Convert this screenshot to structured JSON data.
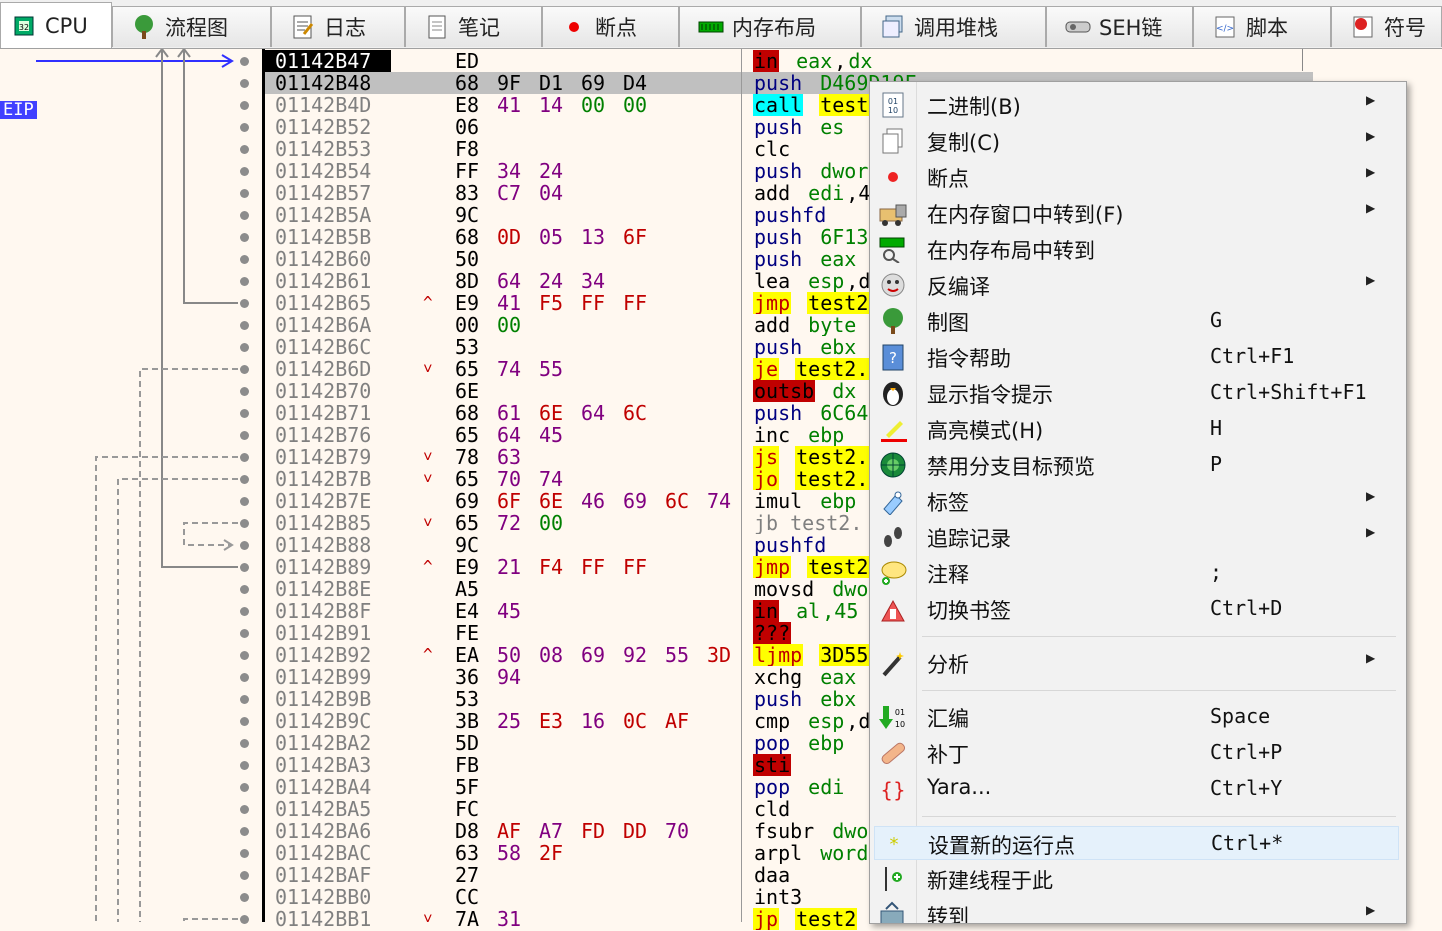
{
  "tabs": [
    {
      "label": "CPU",
      "icon": "cpu-icon",
      "active": true
    },
    {
      "label": "流程图",
      "icon": "tree-icon"
    },
    {
      "label": "日志",
      "icon": "log-icon"
    },
    {
      "label": "笔记",
      "icon": "notes-icon"
    },
    {
      "label": "断点",
      "icon": "breakpoint-icon"
    },
    {
      "label": "内存布局",
      "icon": "memory-map-icon"
    },
    {
      "label": "调用堆栈",
      "icon": "call-stack-icon"
    },
    {
      "label": "SEH链",
      "icon": "seh-chain-icon"
    },
    {
      "label": "脚本",
      "icon": "script-icon"
    },
    {
      "label": "符号",
      "icon": "symbols-icon"
    }
  ],
  "eip_label": "EIP",
  "rows": [
    {
      "addr": "01142B47",
      "bytes": [
        "ED"
      ],
      "ins": [
        [
          "in",
          "mnem-red"
        ],
        [
          " "
        ],
        [
          "eax",
          "op-g"
        ],
        [
          ","
        ],
        [
          "dx",
          "op-g"
        ]
      ],
      "cur": true
    },
    {
      "addr": "01142B48",
      "bytes": [
        "68",
        "9F",
        "D1",
        "69",
        "D4"
      ],
      "ins": [
        [
          "push",
          "mnem"
        ],
        [
          " "
        ],
        [
          "D469D19F",
          "op-g"
        ]
      ],
      "sel": true
    },
    {
      "addr": "01142B4D",
      "bytes": [
        "E8",
        "41",
        "14",
        "00",
        "00"
      ],
      "ins": [
        [
          "call",
          "mnem-cyan"
        ],
        [
          " "
        ],
        [
          "test",
          "op-y"
        ]
      ]
    },
    {
      "addr": "01142B52",
      "bytes": [
        "06"
      ],
      "ins": [
        [
          "push",
          "mnem"
        ],
        [
          " "
        ],
        [
          "es",
          "op-g"
        ]
      ]
    },
    {
      "addr": "01142B53",
      "bytes": [
        "F8"
      ],
      "ins": [
        [
          "clc",
          "plain"
        ]
      ]
    },
    {
      "addr": "01142B54",
      "bytes": [
        "FF",
        "34",
        "24"
      ],
      "ins": [
        [
          "push",
          "mnem"
        ],
        [
          " "
        ],
        [
          "dwor",
          "op-g"
        ]
      ]
    },
    {
      "addr": "01142B57",
      "bytes": [
        "83",
        "C7",
        "04"
      ],
      "ins": [
        [
          "add",
          "plain"
        ],
        [
          " "
        ],
        [
          "edi",
          "op-g"
        ],
        [
          ",4",
          "plain"
        ]
      ]
    },
    {
      "addr": "01142B5A",
      "bytes": [
        "9C"
      ],
      "ins": [
        [
          "pushfd",
          "mnem"
        ]
      ]
    },
    {
      "addr": "01142B5B",
      "bytes": [
        "68",
        "0D",
        "05",
        "13",
        "6F"
      ],
      "ins": [
        [
          "push",
          "mnem"
        ],
        [
          " "
        ],
        [
          "6F13",
          "op-g"
        ]
      ]
    },
    {
      "addr": "01142B60",
      "bytes": [
        "50"
      ],
      "ins": [
        [
          "push",
          "mnem"
        ],
        [
          " "
        ],
        [
          "eax",
          "op-g"
        ]
      ]
    },
    {
      "addr": "01142B61",
      "bytes": [
        "8D",
        "64",
        "24",
        "34"
      ],
      "ins": [
        [
          "lea",
          "plain"
        ],
        [
          " "
        ],
        [
          "esp",
          "op-g"
        ],
        [
          ",d",
          "plain"
        ]
      ]
    },
    {
      "addr": "01142B65",
      "mark": "^",
      "bytes": [
        "E9",
        "41",
        "F5",
        "FF",
        "FF"
      ],
      "ins": [
        [
          "jmp",
          "mnem-y"
        ],
        [
          " "
        ],
        [
          "test2",
          "op-y"
        ]
      ]
    },
    {
      "addr": "01142B6A",
      "bytes": [
        "00",
        "00"
      ],
      "ins": [
        [
          "add",
          "plain"
        ],
        [
          " "
        ],
        [
          "byte",
          "op-g"
        ]
      ]
    },
    {
      "addr": "01142B6C",
      "bytes": [
        "53"
      ],
      "ins": [
        [
          "push",
          "mnem"
        ],
        [
          " "
        ],
        [
          "ebx",
          "op-g"
        ]
      ]
    },
    {
      "addr": "01142B6D",
      "mark": "v",
      "bytes": [
        "65",
        "74",
        "55"
      ],
      "ins": [
        [
          "je",
          "mnem-y"
        ],
        [
          " "
        ],
        [
          "test2.",
          "op-y"
        ]
      ]
    },
    {
      "addr": "01142B70",
      "bytes": [
        "6E"
      ],
      "ins": [
        [
          "outsb",
          "mnem-red"
        ],
        [
          " "
        ],
        [
          "dx",
          "op-g"
        ]
      ]
    },
    {
      "addr": "01142B71",
      "bytes": [
        "68",
        "61",
        "6E",
        "64",
        "6C"
      ],
      "ins": [
        [
          "push",
          "mnem"
        ],
        [
          " "
        ],
        [
          "6C64",
          "op-g"
        ]
      ]
    },
    {
      "addr": "01142B76",
      "bytes": [
        "65",
        "64",
        "45"
      ],
      "ins": [
        [
          "inc",
          "plain"
        ],
        [
          " "
        ],
        [
          "ebp",
          "op-g"
        ]
      ]
    },
    {
      "addr": "01142B79",
      "mark": "v",
      "bytes": [
        "78",
        "63"
      ],
      "ins": [
        [
          "js",
          "mnem-y"
        ],
        [
          " "
        ],
        [
          "test2.",
          "op-y"
        ]
      ]
    },
    {
      "addr": "01142B7B",
      "mark": "v",
      "bytes": [
        "65",
        "70",
        "74"
      ],
      "ins": [
        [
          "jo",
          "mnem-y"
        ],
        [
          " "
        ],
        [
          "test2.",
          "op-y"
        ]
      ]
    },
    {
      "addr": "01142B7E",
      "bytes": [
        "69",
        "6F",
        "6E",
        "46",
        "69",
        "6C",
        "74"
      ],
      "ins": [
        [
          "imul",
          "plain"
        ],
        [
          " "
        ],
        [
          "ebp",
          "op-g"
        ]
      ]
    },
    {
      "addr": "01142B85",
      "mark": "v",
      "bytes": [
        "65",
        "72",
        "00"
      ],
      "ins": [
        [
          "jb test2.",
          "gray"
        ]
      ]
    },
    {
      "addr": "01142B88",
      "bytes": [
        "9C"
      ],
      "ins": [
        [
          "pushfd",
          "mnem"
        ]
      ]
    },
    {
      "addr": "01142B89",
      "mark": "^",
      "bytes": [
        "E9",
        "21",
        "F4",
        "FF",
        "FF"
      ],
      "ins": [
        [
          "jmp",
          "mnem-y"
        ],
        [
          " "
        ],
        [
          "test2",
          "op-y"
        ]
      ]
    },
    {
      "addr": "01142B8E",
      "bytes": [
        "A5"
      ],
      "ins": [
        [
          "movsd",
          "plain"
        ],
        [
          " "
        ],
        [
          "dwo",
          "op-g"
        ]
      ]
    },
    {
      "addr": "01142B8F",
      "bytes": [
        "E4",
        "45"
      ],
      "ins": [
        [
          "in",
          "mnem-red"
        ],
        [
          " "
        ],
        [
          "al",
          "op-g"
        ],
        [
          ",45",
          "op-g"
        ]
      ]
    },
    {
      "addr": "01142B91",
      "bytes": [
        "FE"
      ],
      "ins": [
        [
          "???",
          "mnem-red"
        ]
      ]
    },
    {
      "addr": "01142B92",
      "mark": "^",
      "bytes": [
        "EA",
        "50",
        "08",
        "69",
        "92",
        "55",
        "3D"
      ],
      "ins": [
        [
          "ljmp",
          "mnem-y"
        ],
        [
          " "
        ],
        [
          "3D55",
          "op-y"
        ]
      ]
    },
    {
      "addr": "01142B99",
      "bytes": [
        "36",
        "94"
      ],
      "ins": [
        [
          "xchg",
          "plain"
        ],
        [
          " "
        ],
        [
          "eax",
          "op-g"
        ]
      ]
    },
    {
      "addr": "01142B9B",
      "bytes": [
        "53"
      ],
      "ins": [
        [
          "push",
          "mnem"
        ],
        [
          " "
        ],
        [
          "ebx",
          "op-g"
        ]
      ]
    },
    {
      "addr": "01142B9C",
      "bytes": [
        "3B",
        "25",
        "E3",
        "16",
        "0C",
        "AF"
      ],
      "ins": [
        [
          "cmp",
          "plain"
        ],
        [
          " "
        ],
        [
          "esp",
          "op-g"
        ],
        [
          ",d",
          "plain"
        ]
      ]
    },
    {
      "addr": "01142BA2",
      "bytes": [
        "5D"
      ],
      "ins": [
        [
          "pop",
          "mnem"
        ],
        [
          " "
        ],
        [
          "ebp",
          "op-g"
        ]
      ]
    },
    {
      "addr": "01142BA3",
      "bytes": [
        "FB"
      ],
      "ins": [
        [
          "sti",
          "mnem-red"
        ]
      ]
    },
    {
      "addr": "01142BA4",
      "bytes": [
        "5F"
      ],
      "ins": [
        [
          "pop",
          "mnem"
        ],
        [
          " "
        ],
        [
          "edi",
          "op-g"
        ]
      ]
    },
    {
      "addr": "01142BA5",
      "bytes": [
        "FC"
      ],
      "ins": [
        [
          "cld",
          "plain"
        ]
      ]
    },
    {
      "addr": "01142BA6",
      "bytes": [
        "D8",
        "AF",
        "A7",
        "FD",
        "DD",
        "70"
      ],
      "ins": [
        [
          "fsubr",
          "plain"
        ],
        [
          " "
        ],
        [
          "dwo",
          "op-g"
        ]
      ]
    },
    {
      "addr": "01142BAC",
      "bytes": [
        "63",
        "58",
        "2F"
      ],
      "ins": [
        [
          "arpl",
          "plain"
        ],
        [
          " "
        ],
        [
          "word",
          "op-g"
        ]
      ]
    },
    {
      "addr": "01142BAF",
      "bytes": [
        "27"
      ],
      "ins": [
        [
          "daa",
          "plain"
        ]
      ]
    },
    {
      "addr": "01142BB0",
      "bytes": [
        "CC"
      ],
      "ins": [
        [
          "int3",
          "plain"
        ]
      ]
    },
    {
      "addr": "01142BB1",
      "mark": "v",
      "bytes": [
        "7A",
        "31"
      ],
      "ins": [
        [
          "jp",
          "mnem-y"
        ],
        [
          " "
        ],
        [
          "test2",
          "op-y"
        ]
      ]
    }
  ],
  "context_menu": {
    "items": [
      {
        "label": "二进制(B)",
        "icon": "binary-icon",
        "submenu": true
      },
      {
        "label": "复制(C)",
        "icon": "copy-icon",
        "submenu": true
      },
      {
        "label": "断点",
        "icon": "breakpoint-dot-icon",
        "submenu": true
      },
      {
        "label": "在内存窗口中转到(F)",
        "icon": "dump-icon",
        "submenu": true
      },
      {
        "label": "在内存布局中转到",
        "icon": "memory-map-search-icon"
      },
      {
        "label": "反编译",
        "icon": "decompile-icon",
        "submenu": true
      },
      {
        "label": "制图",
        "icon": "graph-tree-icon",
        "shortcut": "G"
      },
      {
        "label": "指令帮助",
        "icon": "help-book-icon",
        "shortcut": "Ctrl+F1"
      },
      {
        "label": "显示指令提示",
        "icon": "penguin-icon",
        "shortcut": "Ctrl+Shift+F1"
      },
      {
        "label": "高亮模式(H)",
        "icon": "highlight-pen-icon",
        "shortcut": "H"
      },
      {
        "label": "禁用分支目标预览",
        "icon": "branch-preview-icon",
        "shortcut": "P"
      },
      {
        "label": "标签",
        "icon": "label-icon",
        "submenu": true
      },
      {
        "label": "追踪记录",
        "icon": "footprints-icon",
        "submenu": true
      },
      {
        "label": "注释",
        "icon": "comment-icon",
        "shortcut": ";"
      },
      {
        "label": "切换书签",
        "icon": "bookmark-icon",
        "shortcut": "Ctrl+D"
      },
      {
        "label": "分析",
        "icon": "magic-wand-icon",
        "submenu": true,
        "sep_before": true
      },
      {
        "label": "汇编",
        "icon": "assemble-icon",
        "shortcut": "Space",
        "sep_before": true
      },
      {
        "label": "补丁",
        "icon": "bandage-icon",
        "shortcut": "Ctrl+P"
      },
      {
        "label": "Yara...",
        "icon": "yara-icon",
        "shortcut": "Ctrl+Y"
      },
      {
        "label": "设置新的运行点",
        "icon": "new-origin-icon",
        "shortcut": "Ctrl+*",
        "sep_before": true,
        "hover": true
      },
      {
        "label": "新建线程于此",
        "icon": "new-thread-icon"
      },
      {
        "label": "转到",
        "icon": "goto-icon",
        "submenu": true
      }
    ]
  },
  "colors": {
    "mnem_yellow": "#ffff00",
    "mnem_cyan": "#00ffff",
    "mnem_red": "#c00000",
    "operand_green": "#008000",
    "byte_red": "#c00000",
    "byte_magenta": "#800080",
    "byte_green": "#008000"
  }
}
